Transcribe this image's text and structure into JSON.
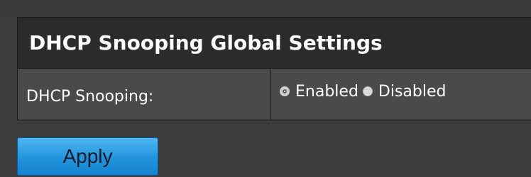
{
  "section": {
    "title": "DHCP Snooping Global Settings"
  },
  "dhcp_snooping": {
    "label": "DHCP Snooping:",
    "options": [
      {
        "label": "Enabled",
        "selected": true
      },
      {
        "label": "Disabled",
        "selected": false
      }
    ]
  },
  "actions": {
    "apply_label": "Apply"
  },
  "colors": {
    "background": "#3c3c3c",
    "header_background": "#2b2b2b",
    "row_background": "#4a4a4a",
    "apply_button": "#2294dd"
  }
}
